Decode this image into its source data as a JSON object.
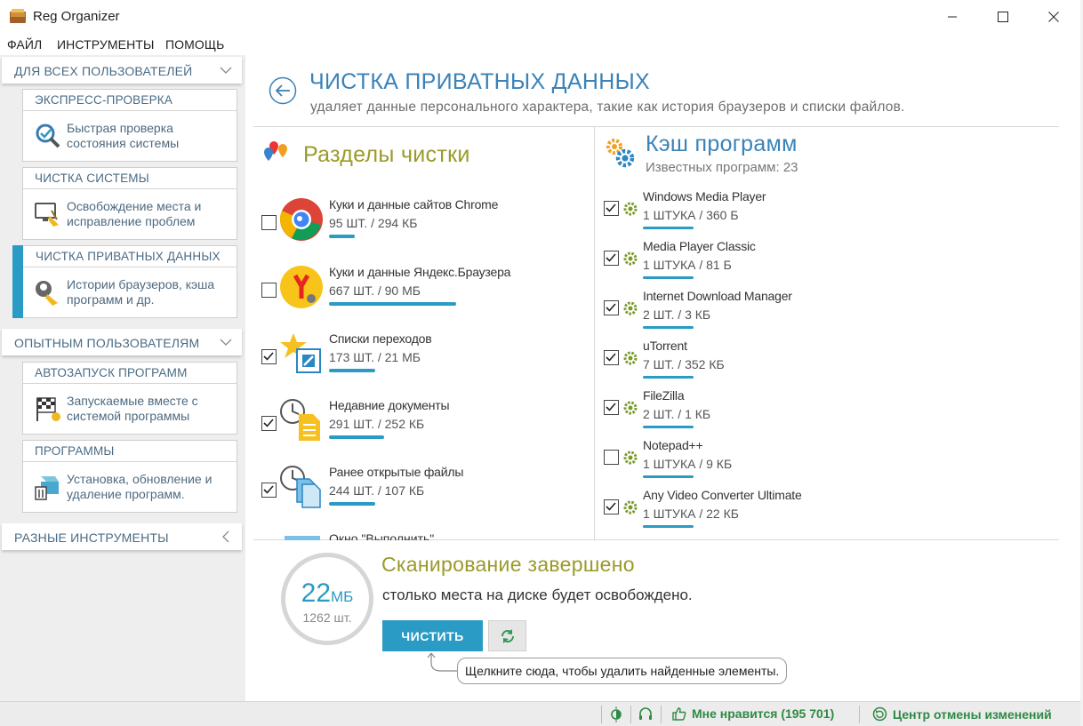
{
  "window": {
    "title": "Reg Organizer"
  },
  "menu": [
    "ФАЙЛ",
    "ИНСТРУМЕНТЫ",
    "ПОМОЩЬ"
  ],
  "sidebar": {
    "sections": [
      {
        "label": "ДЛЯ ВСЕХ ПОЛЬЗОВАТЕЛЕЙ"
      },
      {
        "label": "ОПЫТНЫМ ПОЛЬЗОВАТЕЛЯМ"
      },
      {
        "label": "РАЗНЫЕ ИНСТРУМЕНТЫ"
      }
    ],
    "cards": [
      {
        "head": "ЭКСПРЕСС-ПРОВЕРКА",
        "desc": "Быстрая проверка состояния системы",
        "icon": "magnifier-check-icon"
      },
      {
        "head": "ЧИСТКА СИСТЕМЫ",
        "desc": "Освобождение места и исправление проблем",
        "icon": "monitor-broom-icon"
      },
      {
        "head": "ЧИСТКА ПРИВАТНЫХ ДАННЫХ",
        "desc": "Истории браузеров, кэша программ и др.",
        "icon": "private-broom-icon",
        "active": true
      },
      {
        "head": "АВТОЗАПУСК ПРОГРАММ",
        "desc": "Запускаемые вместе с системой программы",
        "icon": "startup-flag-icon"
      },
      {
        "head": "ПРОГРАММЫ",
        "desc": "Установка, обновление и удаление программ.",
        "icon": "uninstall-box-icon"
      }
    ]
  },
  "header": {
    "title": "ЧИСТКА ПРИВАТНЫХ ДАННЫХ",
    "subtitle": "удаляет данные персонального характера, такие как история браузеров и списки файлов."
  },
  "sections_panel": {
    "title": "Разделы чистки",
    "items": [
      {
        "name": "Куки и данные сайтов Chrome",
        "count": "95 ШТ. / 294 КБ",
        "checked": false,
        "icon": "chrome-icon",
        "bar": 0.11
      },
      {
        "name": "Куки и данные Яндекс.Браузера",
        "count": "667 ШТ. / 90 МБ",
        "checked": false,
        "icon": "yandex-browser-icon",
        "bar": 0.55
      },
      {
        "name": "Списки переходов",
        "count": "173 ШТ. / 21 МБ",
        "checked": true,
        "icon": "jumplist-star-icon",
        "bar": 0.2
      },
      {
        "name": "Недавние документы",
        "count": "291 ШТ. / 252 КБ",
        "checked": true,
        "icon": "recent-docs-icon",
        "bar": 0.24
      },
      {
        "name": "Ранее открытые файлы",
        "count": "244 ШТ. / 107 КБ",
        "checked": true,
        "icon": "recent-files-icon",
        "bar": 0.2
      }
    ],
    "partial_item": "Окно \"Выполнить\""
  },
  "cache_panel": {
    "title": "Кэш программ",
    "subtitle": "Известных программ: 23",
    "items": [
      {
        "name": "Windows Media Player",
        "count": "1 ШТУКА / 360 Б",
        "checked": true,
        "bar": 0.2
      },
      {
        "name": "Media Player Classic",
        "count": "1 ШТУКА / 81 Б",
        "checked": true,
        "bar": 0.2
      },
      {
        "name": "Internet Download Manager",
        "count": "2 ШТ. / 3 КБ",
        "checked": true,
        "bar": 0.2
      },
      {
        "name": "uTorrent",
        "count": "7 ШТ. / 352 КБ",
        "checked": true,
        "bar": 0.2
      },
      {
        "name": "FileZilla",
        "count": "2 ШТ. / 1 КБ",
        "checked": true,
        "bar": 0.2
      },
      {
        "name": "Notepad++",
        "count": "1 ШТУКА / 9 КБ",
        "checked": false,
        "bar": 0.2
      },
      {
        "name": "Any Video Converter Ultimate",
        "count": "1 ШТУКА / 22 КБ",
        "checked": true,
        "bar": 0.2
      }
    ]
  },
  "scan": {
    "size_value": "22",
    "size_unit": "МБ",
    "count": "1262 шт.",
    "title": "Сканирование завершено",
    "subtitle": "столько места на диске будет освобождено.",
    "clean_label": "ЧИСТИТЬ",
    "tooltip": "Щелкните сюда, чтобы удалить найденные элементы."
  },
  "statusbar": {
    "like": "Мне нравится (195 701)",
    "undo": "Центр отмены изменений"
  },
  "colors": {
    "accent": "#2a9bc4",
    "title_blue": "#3a82b8",
    "olive": "#9a9a2a",
    "status_green": "#2e8a44"
  }
}
